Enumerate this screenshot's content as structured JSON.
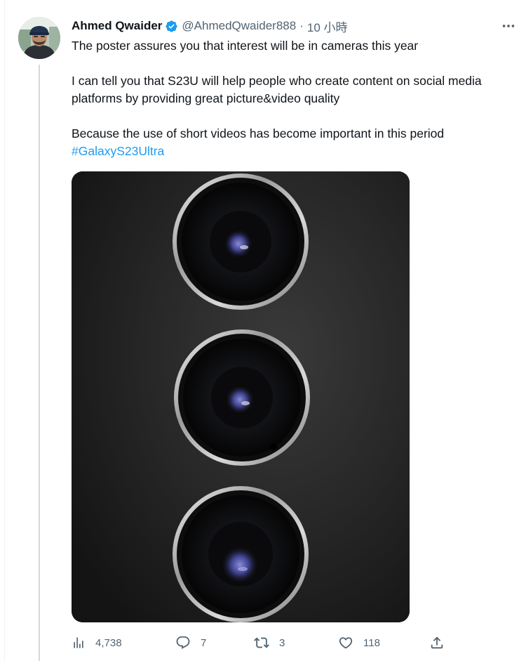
{
  "tweet": {
    "author": {
      "display_name": "Ahmed Qwaider",
      "handle": "@AhmedQwaider888",
      "verified": true
    },
    "separator": "·",
    "timestamp": "10 小時",
    "paragraphs": [
      [
        "The poster assures you that interest will be in cameras this year"
      ],
      [
        "I can tell you that S23U will help people who create content on social media",
        "platforms by providing great picture&video quality"
      ],
      [
        "Because the use of short videos has become important in this period"
      ]
    ],
    "hashtag": "#GalaxyS23Ultra",
    "more_icon": "more-horizontal-icon",
    "media": {
      "kind": "image",
      "subject": "three-camera-lenses"
    },
    "actions": {
      "views": {
        "icon": "analytics-icon",
        "count": "4,738"
      },
      "replies": {
        "icon": "reply-icon",
        "count": "7"
      },
      "retweets": {
        "icon": "retweet-icon",
        "count": "3"
      },
      "likes": {
        "icon": "heart-icon",
        "count": "118"
      },
      "share": {
        "icon": "share-icon"
      }
    }
  },
  "colors": {
    "link": "#1d9bf0",
    "text": "#0f1419",
    "muted": "#536471",
    "verified": "#1d9bf0",
    "thread_line": "#cfd9de"
  }
}
